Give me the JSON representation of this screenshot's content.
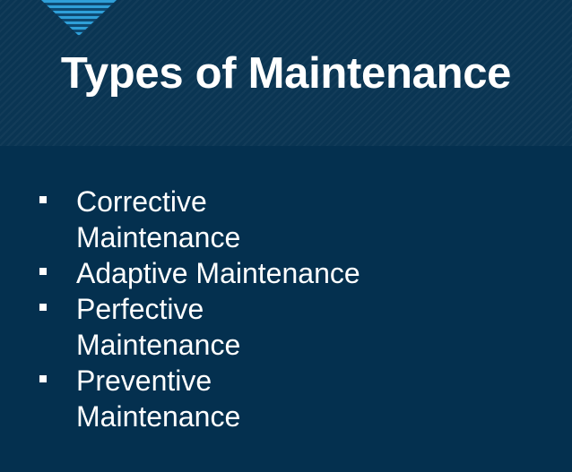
{
  "slide": {
    "title": "Types of Maintenance",
    "bullets": [
      {
        "line1": "Corrective",
        "line2": "Maintenance"
      },
      {
        "line1": "Adaptive Maintenance",
        "line2": ""
      },
      {
        "line1": "Perfective",
        "line2": "Maintenance"
      },
      {
        "line1": "Preventive",
        "line2": "Maintenance"
      }
    ]
  },
  "colors": {
    "background": "#04304f",
    "header": "#0a3553",
    "text": "#ffffff",
    "chevron": "#2f9fd8"
  },
  "icons": {
    "top_ornament": "chevron-down-striped-icon",
    "bullet": "square-bullet-icon"
  }
}
